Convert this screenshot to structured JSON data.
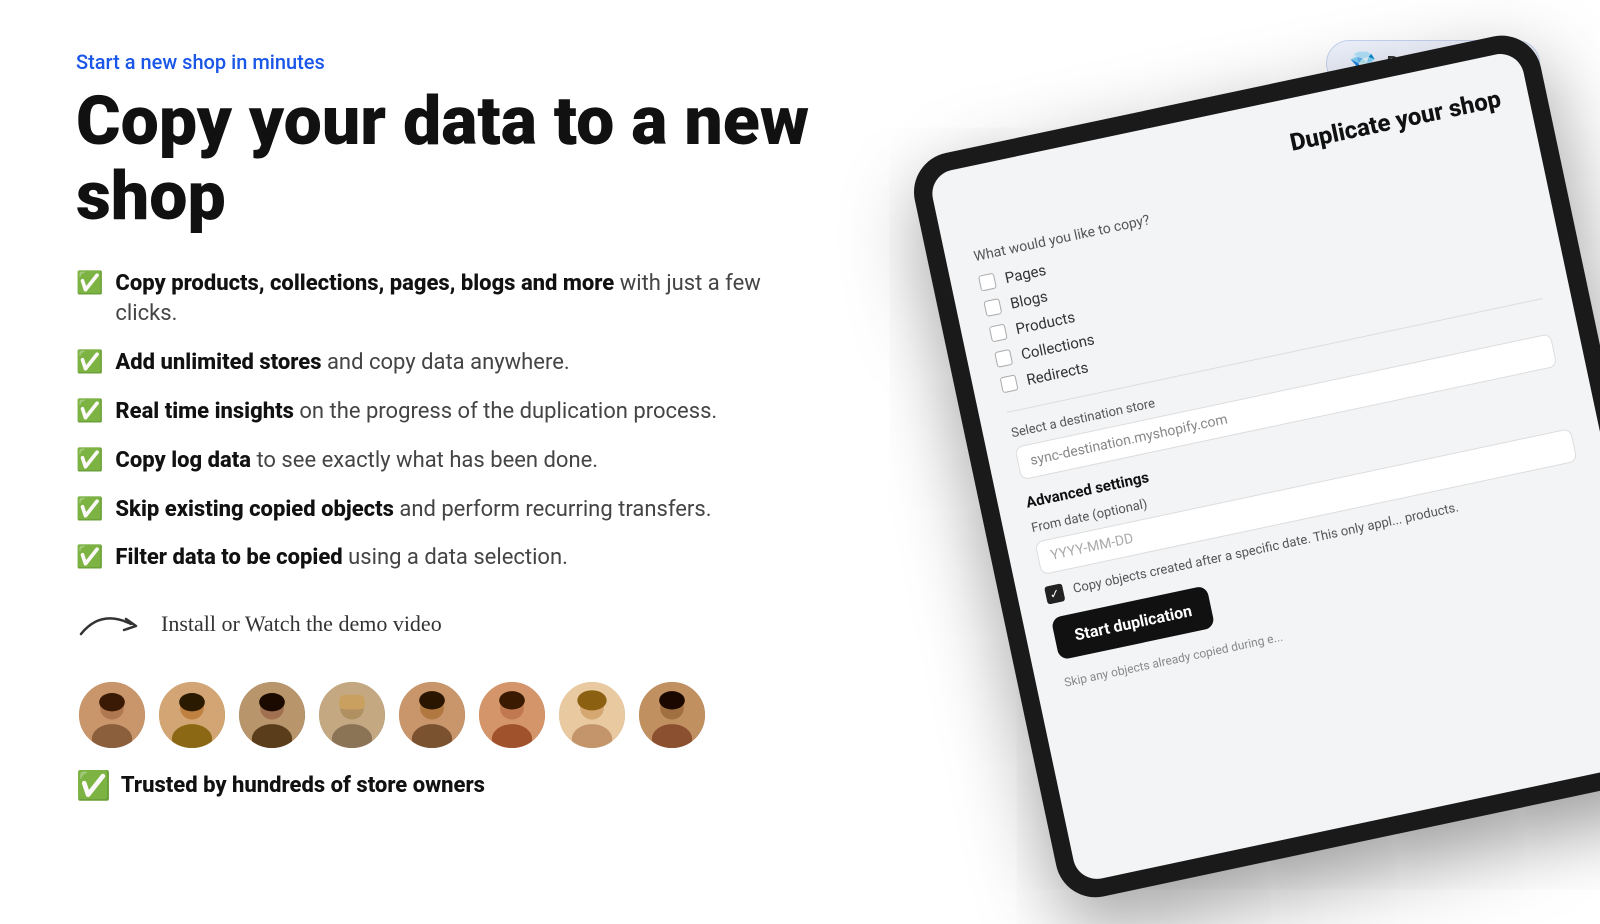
{
  "badge": {
    "icon": "💎",
    "label": "Built for Shopify"
  },
  "hero": {
    "tagline": "Start a new shop in minutes",
    "heading": "Copy your data to a new shop"
  },
  "features": [
    {
      "bold": "Copy products, collections, pages, blogs and more",
      "rest": " with just a few clicks."
    },
    {
      "bold": "Add unlimited stores",
      "rest": " and copy data anywhere."
    },
    {
      "bold": "Real time insights",
      "rest": " on the progress of the duplication process."
    },
    {
      "bold": "Copy log data",
      "rest": " to see exactly what has been done."
    },
    {
      "bold": "Skip existing copied objects",
      "rest": " and perform recurring transfers."
    },
    {
      "bold": "Filter data to be copied",
      "rest": " using a data selection."
    }
  ],
  "demo": {
    "label": "Install or Watch the demo video"
  },
  "trusted": {
    "label": "Trusted by hundreds of store owners"
  },
  "screen": {
    "title": "Duplicate your shop",
    "what_label": "What would you like to copy?",
    "checkboxes": [
      "Pages",
      "Blogs",
      "Products",
      "Collections",
      "Redirects"
    ],
    "dest_label": "Select a destination store",
    "dest_placeholder": "sync-destination.myshopify.com",
    "advanced_label": "Advanced settings",
    "date_label": "From date (optional)",
    "date_placeholder": "YYYY-MM-DD",
    "copy_objects_text": "Copy objects created after a specific date. This only appl... products.",
    "skip_text": "Skip any objects already copied during e...",
    "start_btn": "Start duplication"
  },
  "avatars": [
    {
      "label": "person 1",
      "color": "#c9956b"
    },
    {
      "label": "person 2",
      "color": "#8b6914"
    },
    {
      "label": "person 3",
      "color": "#5a3e1b"
    },
    {
      "label": "person 4",
      "color": "#8b7355"
    },
    {
      "label": "person 5",
      "color": "#7a5230"
    },
    {
      "label": "person 6",
      "color": "#a0522d"
    },
    {
      "label": "person 7",
      "color": "#c4956b"
    },
    {
      "label": "person 8",
      "color": "#8b5030"
    }
  ]
}
